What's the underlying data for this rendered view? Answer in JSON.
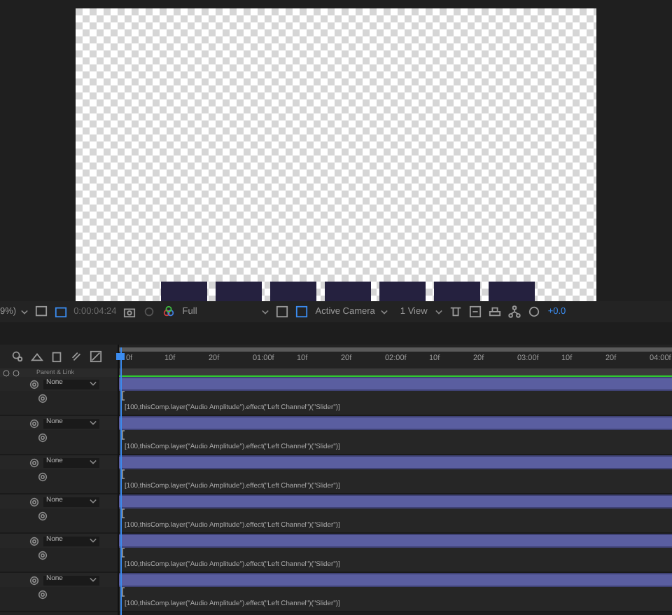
{
  "toolbar": {
    "magnification": "9%)",
    "timecode": "0:00:04:24",
    "resolution": "Full",
    "camera": "Active Camera",
    "views": "1 View",
    "exposure": "+0.0"
  },
  "ruler": [
    "0f",
    "10f",
    "20f",
    "01:00f",
    "10f",
    "20f",
    "02:00f",
    "10f",
    "20f",
    "03:00f",
    "10f",
    "20f",
    "04:00f"
  ],
  "columns": {
    "parent": "Parent & Link"
  },
  "layers": [
    {
      "parent": "None",
      "expression": "[100,thisComp.layer(\"Audio Amplitude\").effect(\"Left Channel\")(\"Slider\")]"
    },
    {
      "parent": "None",
      "expression": "[100,thisComp.layer(\"Audio Amplitude\").effect(\"Left Channel\")(\"Slider\")]"
    },
    {
      "parent": "None",
      "expression": "[100,thisComp.layer(\"Audio Amplitude\").effect(\"Left Channel\")(\"Slider\")]"
    },
    {
      "parent": "None",
      "expression": "[100,thisComp.layer(\"Audio Amplitude\").effect(\"Left Channel\")(\"Slider\")]"
    },
    {
      "parent": "None",
      "expression": "[100,thisComp.layer(\"Audio Amplitude\").effect(\"Left Channel\")(\"Slider\")]"
    },
    {
      "parent": "None",
      "expression": "[100,thisComp.layer(\"Audio Amplitude\").effect(\"Left Channel\")(\"Slider\")]"
    }
  ]
}
